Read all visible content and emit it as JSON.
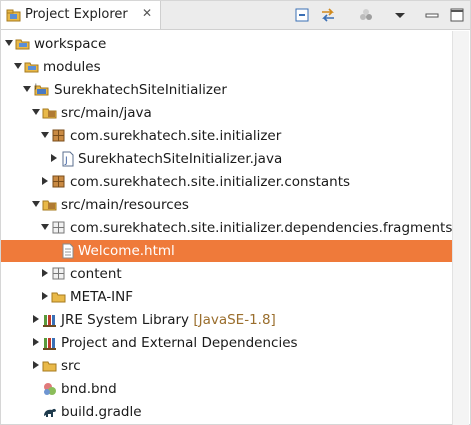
{
  "view": {
    "tab_title": "Project Explorer",
    "tab_close": "✕",
    "toolbar": {
      "collapse_all": "collapse-all-icon",
      "link_with_editor": "link-with-editor-icon",
      "focus": "focus-icon",
      "view_menu": "view-menu-icon",
      "minimize": "minimize-icon",
      "maximize": "maximize-icon"
    }
  },
  "tree": {
    "workspace": "workspace",
    "modules": "modules",
    "project": "SurekhatechSiteInitializer",
    "src_main_java": "src/main/java",
    "pkg_initializer": "com.surekhatech.site.initializer",
    "java_file": "SurekhatechSiteInitializer.java",
    "pkg_constants": "com.surekhatech.site.initializer.constants",
    "src_main_resources": "src/main/resources",
    "pkg_fragments": "com.surekhatech.site.initializer.dependencies.fragments",
    "welcome_html": "Welcome.html",
    "content": "content",
    "meta_inf": "META-INF",
    "jre_label": "JRE System Library",
    "jre_decoration": "[JavaSE-1.8]",
    "project_deps": "Project and External Dependencies",
    "src": "src",
    "bnd": "bnd.bnd",
    "build_gradle": "build.gradle"
  },
  "colors": {
    "selection": "#ef7a3a",
    "folder": "#e9b949",
    "package": "#9c6b2e"
  }
}
